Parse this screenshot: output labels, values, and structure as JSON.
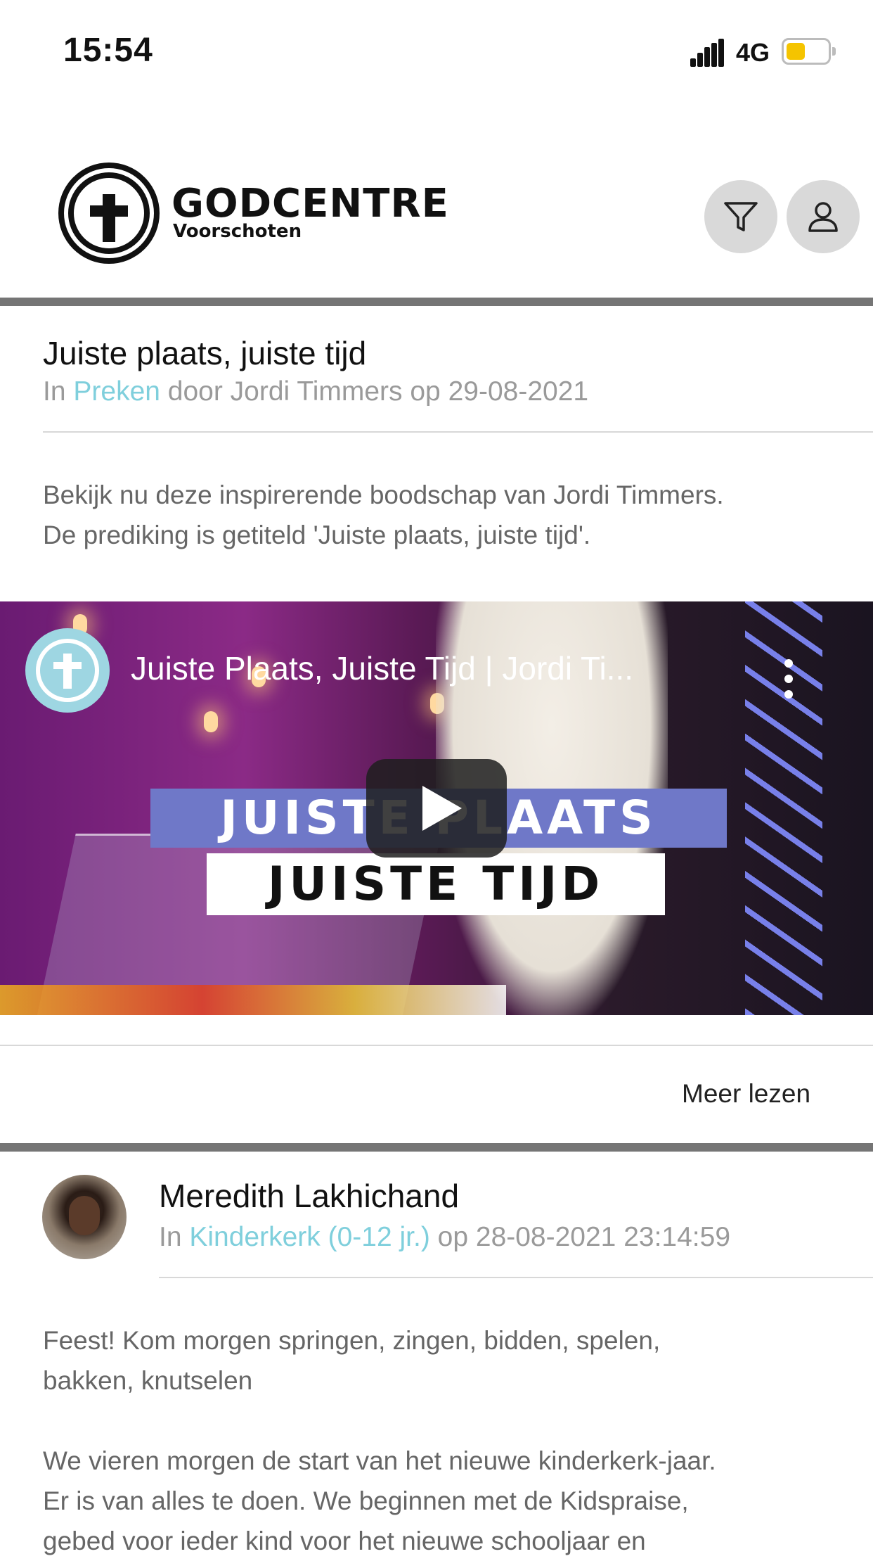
{
  "status_bar": {
    "time": "15:54",
    "network": "4G"
  },
  "header": {
    "brand": "GODCENTRE",
    "brand_sub": "Voorschoten"
  },
  "post1": {
    "title": "Juiste plaats, juiste tijd",
    "meta_in": "In ",
    "category": "Preken",
    "meta_rest": " door Jordi Timmers op 29-08-2021",
    "body_line1": "Bekijk nu deze inspirerende boodschap van Jordi Timmers.",
    "body_line2": "De prediking is getiteld 'Juiste plaats, juiste tijd'.",
    "video": {
      "title": "Juiste Plaats, Juiste Tijd | Jordi Ti...",
      "band1": "JUISTE PLAATS",
      "band2": "JUISTE TIJD"
    },
    "read_more": "Meer lezen"
  },
  "post2": {
    "author": "Meredith Lakhichand",
    "meta_in": "In ",
    "category": "Kinderkerk (0-12 jr.)",
    "meta_rest": " op 28-08-2021 23:14:59",
    "para1_line1": "Feest! Kom morgen springen, zingen, bidden, spelen,",
    "para1_line2": "bakken, knutselen",
    "para2_line1": "We vieren morgen de start van het nieuwe kinderkerk-jaar.",
    "para2_line2": "Er is van alles te doen. We beginnen met de Kidspraise,",
    "para2_line3": "gebed voor ieder kind voor het nieuwe schooljaar en"
  },
  "colors": {
    "accent": "#7fcfdc",
    "divider": "#757575",
    "button_bg": "#d9d9d9",
    "battery": "#f5c400"
  },
  "icons": [
    "signal-icon",
    "battery-icon",
    "logo-icon",
    "filter-icon",
    "profile-icon",
    "channel-logo-icon",
    "more-vertical-icon",
    "play-icon"
  ]
}
